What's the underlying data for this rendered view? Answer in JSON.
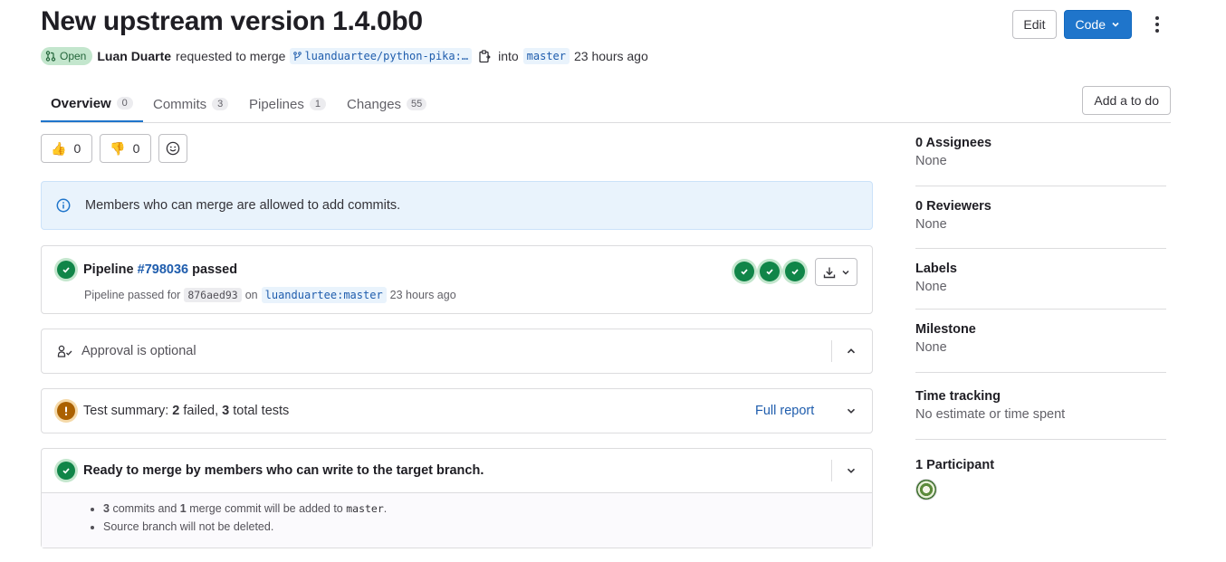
{
  "header": {
    "title": "New upstream version 1.4.0b0",
    "edit_label": "Edit",
    "code_label": "Code"
  },
  "meta": {
    "status": "Open",
    "author": "Luan Duarte",
    "action_text": "requested to merge",
    "source_branch": "luanduartee/python-pika:…",
    "into_text": "into",
    "target_branch": "master",
    "time_ago": "23 hours ago"
  },
  "tabs": [
    {
      "label": "Overview",
      "count": "0"
    },
    {
      "label": "Commits",
      "count": "3"
    },
    {
      "label": "Pipelines",
      "count": "1"
    },
    {
      "label": "Changes",
      "count": "55"
    }
  ],
  "todo_label": "Add a to do",
  "awards": {
    "thumbs_up_emoji": "👍",
    "thumbs_up": "0",
    "thumbs_down_emoji": "👎",
    "thumbs_down": "0"
  },
  "alert": {
    "text": "Members who can merge are allowed to add commits."
  },
  "pipeline": {
    "label": "Pipeline",
    "id": "#798036",
    "status": "passed",
    "sub_prefix": "Pipeline passed for",
    "sha": "876aed93",
    "on_text": "on",
    "ref": "luanduartee:master",
    "time_ago": "23 hours ago"
  },
  "approval": {
    "text": "Approval is optional"
  },
  "tests": {
    "prefix": "Test summary:",
    "failed": "2",
    "failed_label": "failed,",
    "total": "3",
    "total_label": "total tests",
    "full_report": "Full report"
  },
  "merge": {
    "title": "Ready to merge by members who can write to the target branch.",
    "commits": "3",
    "commits_text": "commits and",
    "merge_commits": "1",
    "merge_commits_text": "merge commit will be added to",
    "target": "master",
    "period": ".",
    "source_note": "Source branch will not be deleted."
  },
  "sidebar": {
    "assignees_title": "0 Assignees",
    "assignees_value": "None",
    "reviewers_title": "0 Reviewers",
    "reviewers_value": "None",
    "labels_title": "Labels",
    "labels_value": "None",
    "milestone_title": "Milestone",
    "milestone_value": "None",
    "time_title": "Time tracking",
    "time_value": "No estimate or time spent",
    "participants_title": "1 Participant"
  },
  "colors": {
    "primary": "#1f75cb",
    "success": "#108548",
    "warning": "#ab6100",
    "info_bg": "#e9f3fc",
    "link": "#1f5dad"
  }
}
